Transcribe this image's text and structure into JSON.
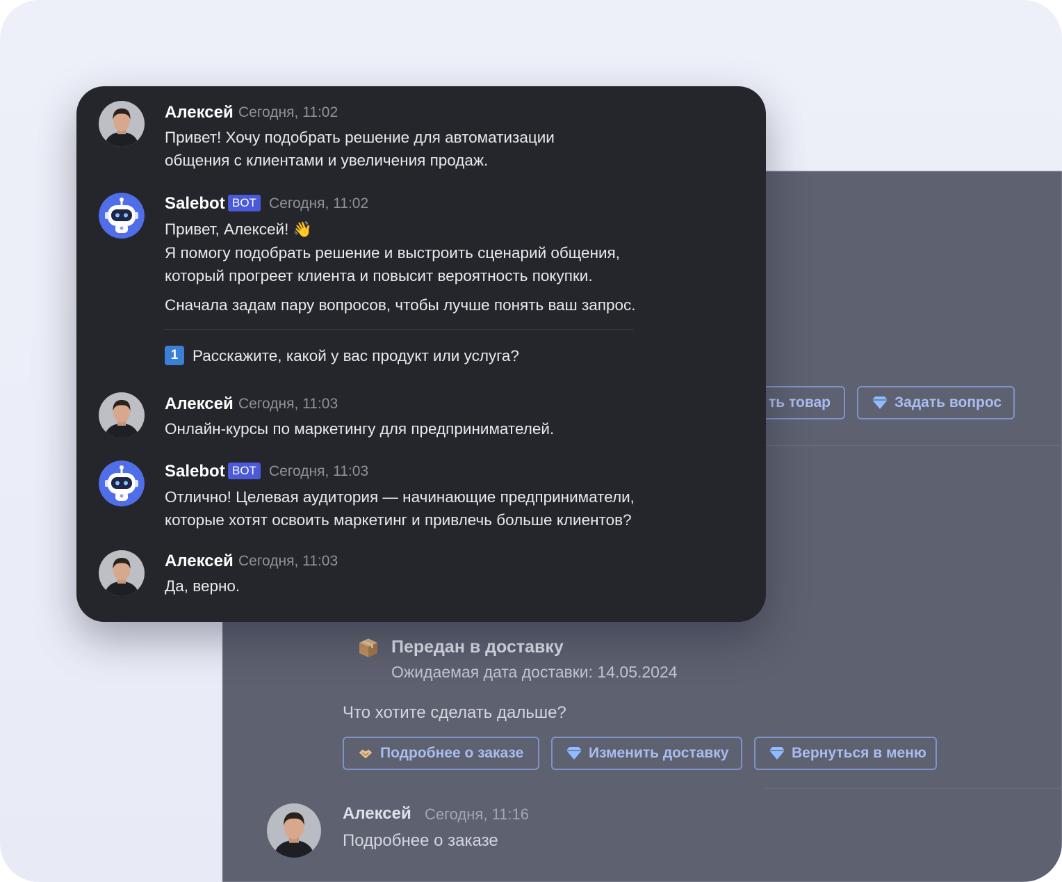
{
  "background_chat": {
    "buttons_top": [
      {
        "label": "ть товар",
        "icon": "partial-button-icon"
      },
      {
        "label": "Задать вопрос",
        "icon": "diamond-icon"
      }
    ],
    "delivery": {
      "icon": "package-icon",
      "title": "Передан в доставку",
      "subtitle": "Ожидаемая дата доставки: 14.05.2024"
    },
    "question": "Что хотите сделать дальше?",
    "buttons_bottom": [
      {
        "label": "Подробнее о заказе",
        "icon": "handshake-icon"
      },
      {
        "label": "Изменить доставку",
        "icon": "diamond-icon"
      },
      {
        "label": "Вернуться в меню",
        "icon": "diamond-icon"
      }
    ],
    "last_message": {
      "author": "Алексей",
      "time": "Сегодня, 11:16",
      "text": "Подробнее о заказе"
    }
  },
  "chat": {
    "bot_badge": "BOT",
    "messages": [
      {
        "author": "Алексей",
        "time": "Сегодня, 11:02",
        "lines": [
          "Привет! Хочу подобрать решение для автоматизации",
          "общения с клиентами и увеличения продаж."
        ]
      },
      {
        "author": "Salebot",
        "time": "Сегодня, 11:02",
        "greeting": "Привет, Алексей!",
        "lines": [
          "Я помогу подобрать решение и выстроить сценарий общения,",
          "который прогреет клиента и повысит вероятность покупки."
        ],
        "extra": "Сначала задам пару вопросов, чтобы лучше понять ваш запрос.",
        "question_number": "1",
        "question": "Расскажите, какой у вас продукт или услуга?"
      },
      {
        "author": "Алексей",
        "time": "Сегодня, 11:03",
        "lines": [
          "Онлайн-курсы по маркетингу для предпринимателей."
        ]
      },
      {
        "author": "Salebot",
        "time": "Сегодня, 11:03",
        "lines": [
          "Отлично! Целевая аудитория — начинающие предприниматели,",
          "которые хотят освоить маркетинг и привлечь больше клиентов?"
        ]
      },
      {
        "author": "Алексей",
        "time": "Сегодня, 11:03",
        "lines": [
          "Да, верно."
        ]
      }
    ]
  },
  "colors": {
    "card_bg": "#25262b",
    "bot_badge": "#4a5ad8",
    "bg_panel": "#5d6170",
    "accent_blue": "#3b7fd6"
  }
}
